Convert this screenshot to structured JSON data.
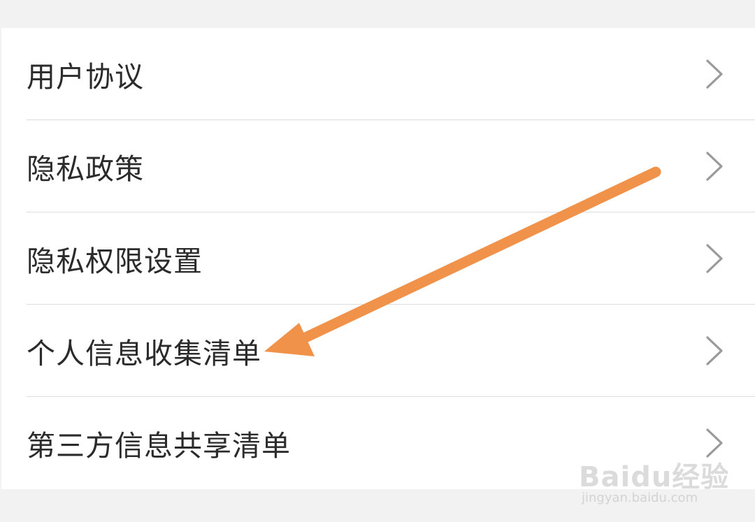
{
  "settings_list": {
    "items": [
      {
        "label": "用户协议"
      },
      {
        "label": "隐私政策"
      },
      {
        "label": "隐私权限设置"
      },
      {
        "label": "个人信息收集清单"
      },
      {
        "label": "第三方信息共享清单"
      }
    ]
  },
  "annotation": {
    "arrow_color": "#f0924a",
    "icon": "arrow-pointer-icon"
  },
  "watermark": {
    "logo_text": "Baidu经验",
    "url_text": "jingyan.baidu.com"
  },
  "colors": {
    "page_background": "#f2f2f2",
    "card_background": "#ffffff",
    "text": "#2b2b2b",
    "chevron": "#9a9a9a",
    "divider": "#dcdcdc"
  }
}
